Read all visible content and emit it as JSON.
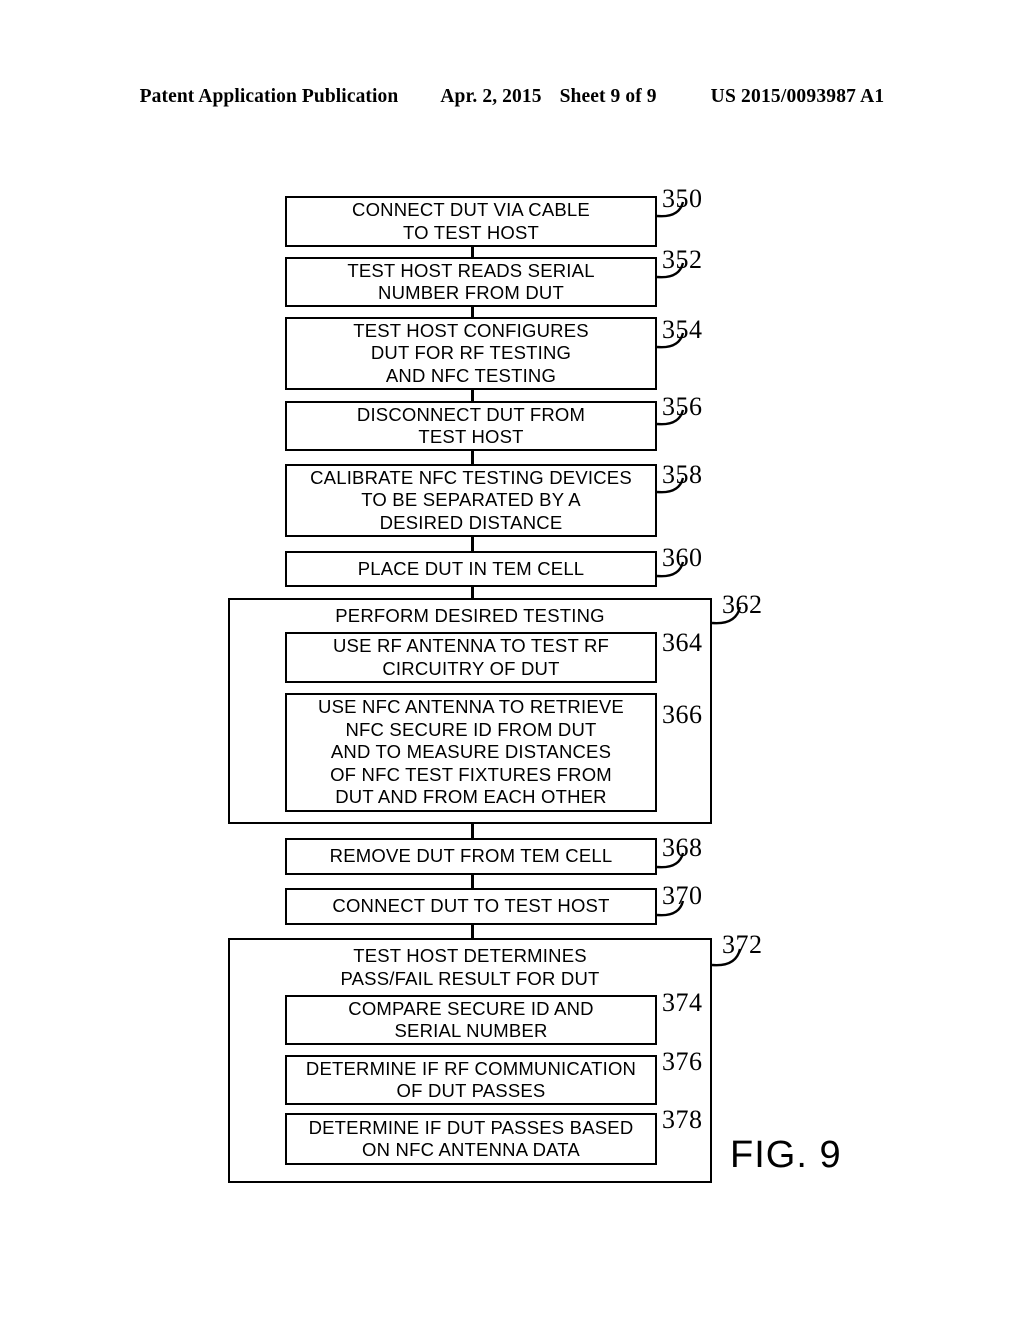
{
  "header": {
    "publication": "Patent Application Publication",
    "date": "Apr. 2, 2015",
    "sheet": "Sheet 9 of 9",
    "patent_number": "US 2015/0093987 A1"
  },
  "figure": {
    "label": "FIG. 9",
    "type": "flowchart",
    "line_color": "#000000",
    "background": "#ffffff"
  },
  "flowchart": {
    "steps": [
      {
        "ref": "350",
        "lines": [
          "CONNECT DUT VIA CABLE",
          "TO TEST HOST"
        ]
      },
      {
        "ref": "352",
        "lines": [
          "TEST HOST READS SERIAL",
          "NUMBER FROM DUT"
        ]
      },
      {
        "ref": "354",
        "lines": [
          "TEST HOST CONFIGURES",
          "DUT FOR RF TESTING",
          "AND NFC TESTING"
        ]
      },
      {
        "ref": "356",
        "lines": [
          "DISCONNECT DUT FROM",
          "TEST HOST"
        ]
      },
      {
        "ref": "358",
        "lines": [
          "CALIBRATE NFC TESTING DEVICES",
          "TO BE SEPARATED BY A",
          "DESIRED DISTANCE"
        ]
      },
      {
        "ref": "360",
        "lines": [
          "PLACE DUT IN TEM CELL"
        ]
      },
      {
        "ref": "362",
        "title": "PERFORM DESIRED TESTING",
        "substeps": [
          {
            "ref": "364",
            "lines": [
              "USE RF ANTENNA TO TEST RF",
              "CIRCUITRY OF DUT"
            ]
          },
          {
            "ref": "366",
            "lines": [
              "USE NFC ANTENNA TO RETRIEVE",
              "NFC SECURE ID FROM DUT",
              "AND TO MEASURE DISTANCES",
              "OF NFC TEST FIXTURES FROM",
              "DUT AND FROM EACH OTHER"
            ]
          }
        ]
      },
      {
        "ref": "368",
        "lines": [
          "REMOVE DUT FROM TEM CELL"
        ]
      },
      {
        "ref": "370",
        "lines": [
          "CONNECT DUT TO TEST HOST"
        ]
      },
      {
        "ref": "372",
        "title_lines": [
          "TEST HOST DETERMINES",
          "PASS/FAIL RESULT FOR DUT"
        ],
        "substeps": [
          {
            "ref": "374",
            "lines": [
              "COMPARE SECURE ID AND",
              "SERIAL NUMBER"
            ]
          },
          {
            "ref": "376",
            "lines": [
              "DETERMINE IF RF COMMUNICATION",
              "OF DUT PASSES"
            ]
          },
          {
            "ref": "378",
            "lines": [
              "DETERMINE IF DUT PASSES BASED",
              "ON NFC ANTENNA DATA"
            ]
          }
        ]
      }
    ]
  }
}
